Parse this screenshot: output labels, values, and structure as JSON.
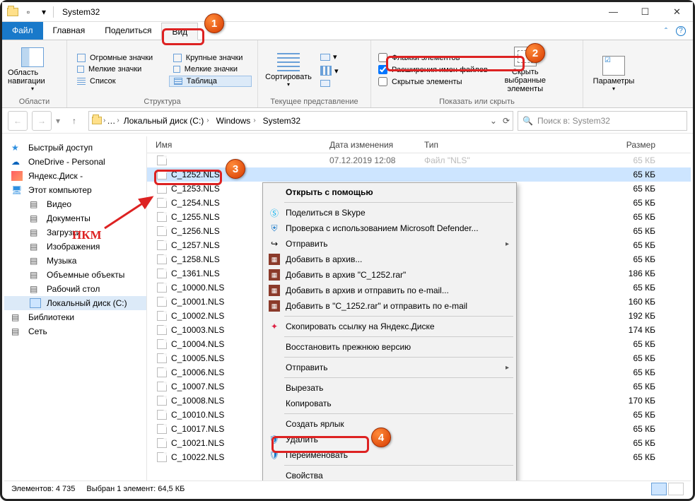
{
  "title": "System32",
  "tabs": {
    "file": "Файл",
    "home": "Главная",
    "share": "Поделиться",
    "view": "Вид"
  },
  "ribbon": {
    "nav_pane": "Область навигации",
    "layouts": {
      "huge": "Огромные значки",
      "large": "Крупные значки",
      "small": "Мелкие значки",
      "medium": "Мелкие значки",
      "list": "Список",
      "table": "Таблица"
    },
    "sort": "Сортировать",
    "add_cols": "",
    "flags": "Флажки элементов",
    "ext": "Расширения имен файлов",
    "hidden": "Скрытые элементы",
    "hide_sel": "Скрыть выбранные элементы",
    "options": "Параметры",
    "grp_nav": "Области",
    "grp_layout": "Структура",
    "grp_view": "Текущее представление",
    "grp_show": "Показать или скрыть"
  },
  "breadcrumbs": [
    "Локальный диск (C:)",
    "Windows",
    "System32"
  ],
  "search_placeholder": "Поиск в: System32",
  "columns": {
    "name": "Имя",
    "date": "Дата изменения",
    "type": "Тип",
    "size": "Размер"
  },
  "sidebar": [
    {
      "label": "Быстрый доступ",
      "icon": "star"
    },
    {
      "label": "OneDrive - Personal",
      "icon": "cloud"
    },
    {
      "label": "Яндекс.Диск - ",
      "icon": "ydisk"
    },
    {
      "label": "Этот компьютер",
      "icon": "pc"
    },
    {
      "label": "Видео",
      "icon": "gen",
      "indent": true
    },
    {
      "label": "Документы",
      "icon": "gen",
      "indent": true
    },
    {
      "label": "Загрузки",
      "icon": "gen",
      "indent": true
    },
    {
      "label": "Изображения",
      "icon": "gen",
      "indent": true
    },
    {
      "label": "Музыка",
      "icon": "gen",
      "indent": true
    },
    {
      "label": "Объемные объекты",
      "icon": "gen",
      "indent": true
    },
    {
      "label": "Рабочий стол",
      "icon": "gen",
      "indent": true
    },
    {
      "label": "Локальный диск (C:)",
      "icon": "drive",
      "indent": true,
      "sel": true
    },
    {
      "label": "Библиотеки",
      "icon": "gen"
    },
    {
      "label": "Сеть",
      "icon": "gen"
    }
  ],
  "files": [
    {
      "name": "C_1252.NLS",
      "date": "",
      "type": "",
      "size": "65 КБ",
      "sel": true
    },
    {
      "name": "C_1253.NLS",
      "date": "",
      "type": "",
      "size": "65 КБ"
    },
    {
      "name": "C_1254.NLS",
      "date": "",
      "type": "",
      "size": "65 КБ"
    },
    {
      "name": "C_1255.NLS",
      "date": "",
      "type": "",
      "size": "65 КБ"
    },
    {
      "name": "C_1256.NLS",
      "date": "",
      "type": "",
      "size": "65 КБ"
    },
    {
      "name": "C_1257.NLS",
      "date": "",
      "type": "",
      "size": "65 КБ"
    },
    {
      "name": "C_1258.NLS",
      "date": "",
      "type": "",
      "size": "65 КБ"
    },
    {
      "name": "C_1361.NLS",
      "date": "",
      "type": "",
      "size": "186 КБ"
    },
    {
      "name": "C_10000.NLS",
      "date": "",
      "type": "",
      "size": "65 КБ"
    },
    {
      "name": "C_10001.NLS",
      "date": "",
      "type": "",
      "size": "160 КБ"
    },
    {
      "name": "C_10002.NLS",
      "date": "",
      "type": "",
      "size": "192 КБ"
    },
    {
      "name": "C_10003.NLS",
      "date": "",
      "type": "",
      "size": "174 КБ"
    },
    {
      "name": "C_10004.NLS",
      "date": "",
      "type": "",
      "size": "65 КБ"
    },
    {
      "name": "C_10005.NLS",
      "date": "",
      "type": "",
      "size": "65 КБ"
    },
    {
      "name": "C_10006.NLS",
      "date": "",
      "type": "",
      "size": "65 КБ"
    },
    {
      "name": "C_10007.NLS",
      "date": "",
      "type": "",
      "size": "65 КБ"
    },
    {
      "name": "C_10008.NLS",
      "date": "",
      "type": "",
      "size": "170 КБ"
    },
    {
      "name": "C_10010.NLS",
      "date": "",
      "type": "",
      "size": "65 КБ"
    },
    {
      "name": "C_10017.NLS",
      "date": "",
      "type": "",
      "size": "65 КБ"
    },
    {
      "name": "C_10021.NLS",
      "date": "",
      "type": "",
      "size": "65 КБ"
    },
    {
      "name": "C_10022.NLS",
      "date": "",
      "type": "",
      "size": "65 КБ"
    }
  ],
  "first_row_meta": {
    "date": "07.12.2019 12:08",
    "type": "Файл \"NLS\"",
    "size": "65 КБ"
  },
  "ctx": {
    "open_with": "Открыть с помощью",
    "skype": "Поделиться в Skype",
    "defender": "Проверка с использованием Microsoft Defender...",
    "send": "Отправить",
    "add_arch": "Добавить в архив...",
    "add_rar": "Добавить в архив \"C_1252.rar\"",
    "arch_mail": "Добавить в архив и отправить по e-mail...",
    "rar_mail": "Добавить в \"C_1252.rar\" и отправить по e-mail",
    "yadisk": "Скопировать ссылку на Яндекс.Диске",
    "restore": "Восстановить прежнюю версию",
    "sendto": "Отправить",
    "cut": "Вырезать",
    "copy": "Копировать",
    "shortcut": "Создать ярлык",
    "delete": "Удалить",
    "rename": "Переименовать",
    "props": "Свойства"
  },
  "status": {
    "count_lbl": "Элементов:",
    "count": "4 735",
    "sel_lbl": "Выбран 1 элемент: 64,5 КБ"
  },
  "annotations": {
    "pkm": "ПКМ",
    "c1": "1",
    "c2": "2",
    "c3": "3",
    "c4": "4"
  }
}
